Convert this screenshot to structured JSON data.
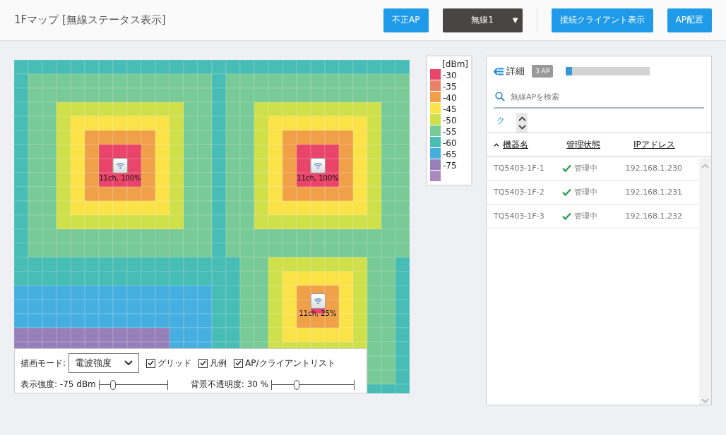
{
  "header": {
    "title": "1Fマップ [無線ステータス表示]",
    "buttons": [
      {
        "kind": "button",
        "label": "不正AP"
      },
      {
        "kind": "select",
        "label": "無線1",
        "caret": "▼"
      },
      {
        "kind": "divider"
      },
      {
        "kind": "button",
        "label": "接続クライアント表示"
      },
      {
        "kind": "button",
        "label": "AP配置"
      }
    ]
  },
  "map": {
    "access_points": [
      {
        "label": "11ch, 100%"
      },
      {
        "label": "11ch, 100%"
      },
      {
        "label": "11ch, 25%"
      }
    ]
  },
  "legend": {
    "title": "[dBm]",
    "items": [
      {
        "label": "-30",
        "color": "#e9446a"
      },
      {
        "label": "-35",
        "color": "#ec8068"
      },
      {
        "label": "-40",
        "color": "#f0a048"
      },
      {
        "label": "-45",
        "color": "#fbe249"
      },
      {
        "label": "-50",
        "color": "#cfe04b"
      },
      {
        "label": "-55",
        "color": "#78ca96"
      },
      {
        "label": "-60",
        "color": "#47bdb5"
      },
      {
        "label": "-65",
        "color": "#47afe0"
      },
      {
        "label": "-75",
        "color": "#9580b9"
      },
      {
        "color": "#ac88c0"
      }
    ]
  },
  "controls": {
    "mode_label": "描画モード:",
    "mode_value": "電波強度",
    "checkboxes": [
      {
        "label": "グリッド",
        "checked": true
      },
      {
        "label": "凡例",
        "checked": true
      },
      {
        "label": "AP/クライアントリスト",
        "checked": true
      }
    ],
    "sliders": [
      {
        "reading": "表示強度: -75 dBm",
        "level": 0.2
      },
      {
        "reading": "背景不透明度: 30 %",
        "level": 0.3
      }
    ]
  },
  "panel": {
    "title": "詳細",
    "badge": "3 AP",
    "progress": {
      "level": 0.07
    },
    "search": {
      "placeholder": "無線APを検索"
    },
    "link": "ク",
    "table": {
      "columns": [
        {
          "label": "機器名",
          "sorted": true
        },
        {
          "label": "管理状態",
          "sorted": false
        },
        {
          "label": "IPアドレス",
          "sorted": false
        }
      ],
      "rows": [
        {
          "name": "TQ5403-1F-1",
          "status": "管理中",
          "ip": "192.168.1.230"
        },
        {
          "name": "TQ5403-1F-2",
          "status": "管理中",
          "ip": "192.168.1.231"
        },
        {
          "name": "TQ5403-1F-3",
          "status": "管理中",
          "ip": "192.168.1.232"
        }
      ]
    }
  }
}
